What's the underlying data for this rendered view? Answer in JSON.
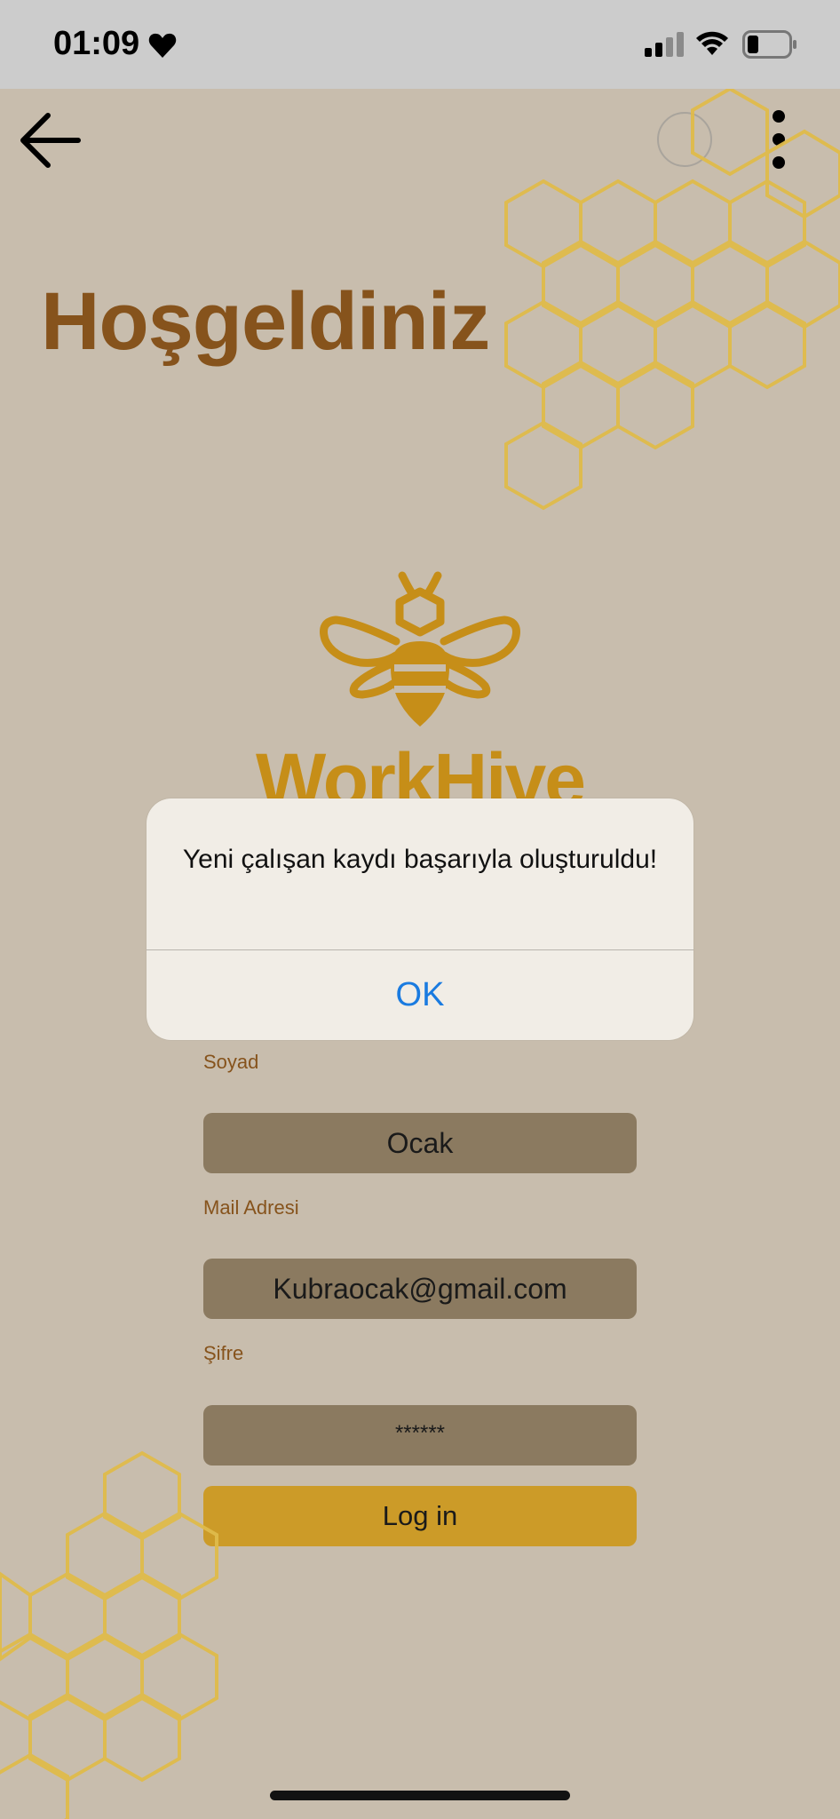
{
  "status_bar": {
    "time": "01:09",
    "icons": [
      "heart-icon",
      "cellular-signal-icon",
      "wifi-icon",
      "battery-icon"
    ]
  },
  "header": {
    "back_icon": "arrow-left-icon",
    "menu_icon": "more-vertical-icon"
  },
  "welcome_title": "Hoşgeldiniz",
  "brand": {
    "logo_icon": "bee-icon",
    "name": "WorkHive"
  },
  "form": {
    "surname_label": "Soyad",
    "surname_value": "Ocak",
    "email_label": "Mail Adresi",
    "email_value": "Kubraocak@gmail.com",
    "password_label": "Şifre",
    "password_value": "******",
    "login_label": "Log in"
  },
  "alert": {
    "message": "Yeni çalışan kaydı başarıyla oluşturuldu!",
    "ok_label": "OK"
  },
  "colors": {
    "background": "#c8bdad",
    "title_brown": "#86531c",
    "honey_gold": "#c68e18",
    "field_brown": "#8b7a60",
    "button_gold": "#cc9b28",
    "link_blue": "#1a7be0"
  }
}
